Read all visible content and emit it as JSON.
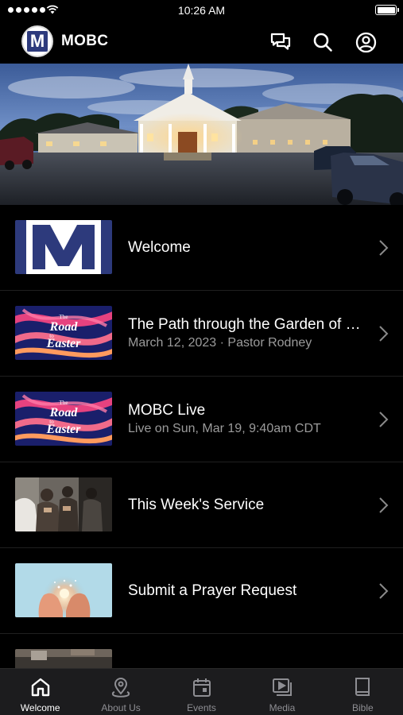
{
  "status_bar": {
    "time": "10:26 AM"
  },
  "header": {
    "title": "MOBC",
    "logo_letter": "M"
  },
  "list": [
    {
      "title": "Welcome",
      "subtitle": "",
      "thumb": "mobc-logo"
    },
    {
      "title": "The Path through the Garden of Gethsemane",
      "subtitle": "March 12, 2023 · Pastor Rodney",
      "thumb": "road-to-easter"
    },
    {
      "title": "MOBC Live",
      "subtitle": "Live on Sun, Mar 19, 9:40am CDT",
      "thumb": "road-to-easter"
    },
    {
      "title": "This Week's Service",
      "subtitle": "",
      "thumb": "congregation-photo"
    },
    {
      "title": "Submit a Prayer Request",
      "subtitle": "",
      "thumb": "hands-light-photo"
    }
  ],
  "thumb_text": {
    "the": "The",
    "road": "Road",
    "to": "to",
    "easter": "Easter"
  },
  "tabs": [
    {
      "label": "Welcome",
      "icon": "home-icon",
      "active": true
    },
    {
      "label": "About Us",
      "icon": "map-pin-icon",
      "active": false
    },
    {
      "label": "Events",
      "icon": "calendar-icon",
      "active": false
    },
    {
      "label": "Media",
      "icon": "media-play-icon",
      "active": false
    },
    {
      "label": "Bible",
      "icon": "book-icon",
      "active": false
    }
  ],
  "colors": {
    "background": "#000000",
    "tab_bar": "#1c1c1e",
    "subtitle": "#9b9b9b",
    "brand_blue": "#2d3a7c"
  }
}
